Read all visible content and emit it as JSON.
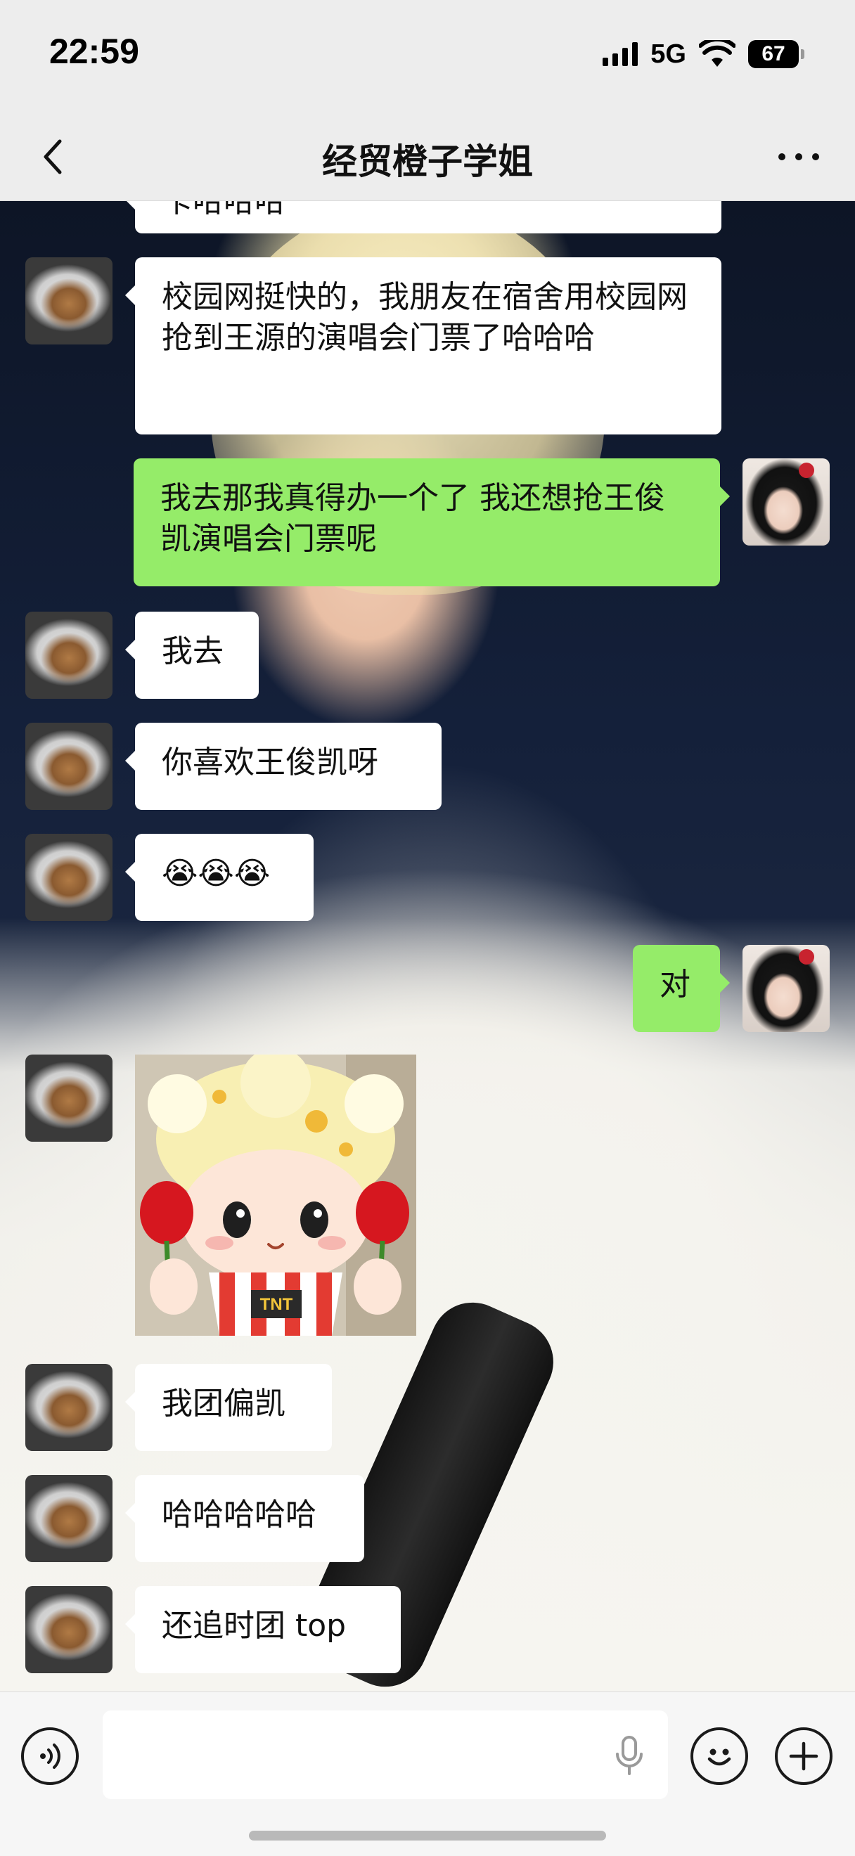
{
  "status_bar": {
    "time": "22:59",
    "network": "5G",
    "battery": "67"
  },
  "nav": {
    "title": "经贸橙子学姐"
  },
  "messages": [
    {
      "side": "in",
      "text": "卡哈哈哈"
    },
    {
      "side": "in",
      "text": "校园网挺快的，我朋友在宿舍用校园网抢到王源的演唱会门票了哈哈哈"
    },
    {
      "side": "out",
      "text": "我去那我真得办一个了 我还想抢王俊凯演唱会门票呢"
    },
    {
      "side": "in",
      "text": "我去"
    },
    {
      "side": "in",
      "text": "你喜欢王俊凯呀"
    },
    {
      "side": "in",
      "text": "😭😭😭"
    },
    {
      "side": "out",
      "text": "对"
    },
    {
      "side": "in",
      "type": "sticker",
      "sticker_text": "TNT"
    },
    {
      "side": "in",
      "text": "我团偏凯"
    },
    {
      "side": "in",
      "text": "哈哈哈哈哈"
    },
    {
      "side": "in",
      "text": "还追时团 top"
    }
  ],
  "input": {
    "value": "",
    "placeholder": ""
  },
  "icons": {
    "back": "chevron-left-icon",
    "more": "more-dots-icon",
    "voice": "voice-icon",
    "mic": "mic-icon",
    "emoji": "emoji-icon",
    "plus": "plus-icon"
  },
  "colors": {
    "bubble_out": "#95ec69",
    "bubble_in": "#ffffff",
    "bar_bg": "#ededed"
  }
}
